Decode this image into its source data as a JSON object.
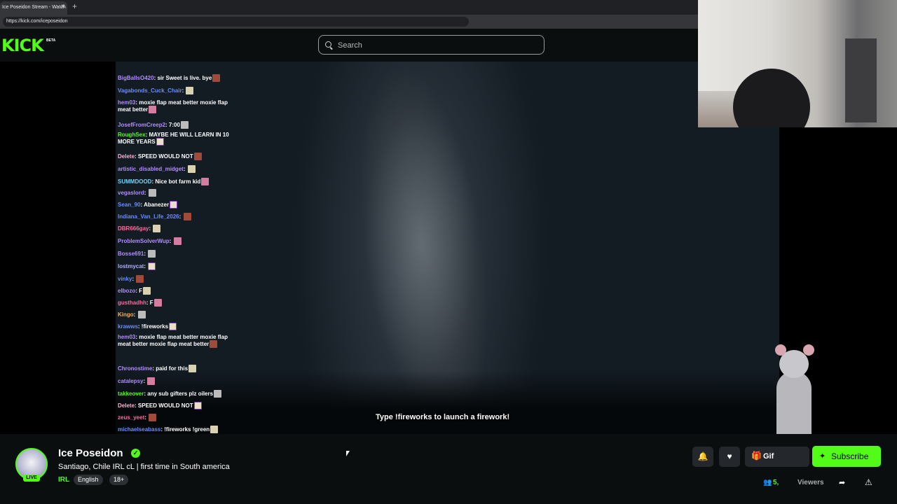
{
  "browser": {
    "tab_title": "Ice Poseidon Stream - Watch",
    "tab_close": "×",
    "new_tab": "+",
    "url": "https://kick.com/iceposeidon"
  },
  "header": {
    "logo": "KICK",
    "beta": "BETA",
    "search_placeholder": "Search"
  },
  "video": {
    "overlay_text": "Type !fireworks to launch a firework!"
  },
  "chat": [
    {
      "user": "BigBallsO420",
      "color": "#b38cff",
      "text": "sir Sweet is live. bye"
    },
    {
      "user": "Vagabonds_Cuck_Chair",
      "color": "#6b8cff",
      "text": ""
    },
    {
      "user": "hem03",
      "color": "#b38cff",
      "text": "moxie flap meat better  moxie flap meat better"
    },
    {
      "user": "JosefFromCreep2",
      "color": "#b38cff",
      "text": "7:00"
    },
    {
      "user": "RoughSex",
      "color": "#53fc18",
      "text": "MAYBE HE WILL LEARN IN 10 MORE YEARS"
    },
    {
      "user": "Delete",
      "color": "#ffb0d0",
      "text": "SPEED WOULD NOT"
    },
    {
      "user": "artistic_disabled_midget",
      "color": "#b38cff",
      "text": ""
    },
    {
      "user": "SUMMDOOD",
      "color": "#6bd7ff",
      "text": "Nice bot farm kid"
    },
    {
      "user": "vegaslord",
      "color": "#b38cff",
      "text": ""
    },
    {
      "user": "Sean_90",
      "color": "#6b8cff",
      "text": "Abanezer"
    },
    {
      "user": "Indiana_Van_Life_2026",
      "color": "#6b8cff",
      "text": ""
    },
    {
      "user": "DBR666gay",
      "color": "#ff6b9e",
      "text": ""
    },
    {
      "user": "ProblemSolverWup",
      "color": "#b38cff",
      "text": ""
    },
    {
      "user": "Bosse691",
      "color": "#b38cff",
      "text": ""
    },
    {
      "user": "lostmycat",
      "color": "#b0b0ff",
      "text": ""
    },
    {
      "user": "vinky",
      "color": "#6b8cff",
      "text": ""
    },
    {
      "user": "elbozo",
      "color": "#b38cff",
      "text": "F"
    },
    {
      "user": "gusthadhh",
      "color": "#ff6b9e",
      "text": "F"
    },
    {
      "user": "Kingo",
      "color": "#ffb04a",
      "text": ""
    },
    {
      "user": "krawws",
      "color": "#6b8cff",
      "text": "!fireworks"
    },
    {
      "user": "hem03",
      "color": "#b38cff",
      "text": "moxie flap meat better  moxie flap meat better  moxie flap meat better"
    },
    {
      "user": "Chronostime",
      "color": "#b38cff",
      "text": "paid for this"
    },
    {
      "user": "catalepsy",
      "color": "#b38cff",
      "text": ""
    },
    {
      "user": "takkeover",
      "color": "#53fc18",
      "text": "any sub gifters plz oilers"
    },
    {
      "user": "Delete",
      "color": "#ffb0d0",
      "text": "SPEED WOULD NOT"
    },
    {
      "user": "zeus_yeet",
      "color": "#ff6b9e",
      "text": ""
    },
    {
      "user": "michaelseabass",
      "color": "#6b8cff",
      "text": "!fireworks !green"
    }
  ],
  "stream": {
    "streamer_name": "Ice Poseidon",
    "live_label": "LIVE",
    "verified_icon": "✓",
    "title": "Santiago, Chile IRL cL | first time in South america",
    "category": "IRL",
    "tags": [
      "English",
      "18+"
    ],
    "gift_label": "Gif",
    "subscribe_label": "Subscribe",
    "viewer_count": "5,",
    "viewers_label": "Viewers"
  },
  "colors": {
    "accent": "#53fc18",
    "background": "#0b0e0f"
  },
  "icons": {
    "bell": "bell-icon",
    "heart": "heart-icon",
    "gift": "gift-icon",
    "star": "star-icon",
    "users": "users-icon",
    "share": "share-icon",
    "report": "warning-icon",
    "search": "search-icon"
  }
}
